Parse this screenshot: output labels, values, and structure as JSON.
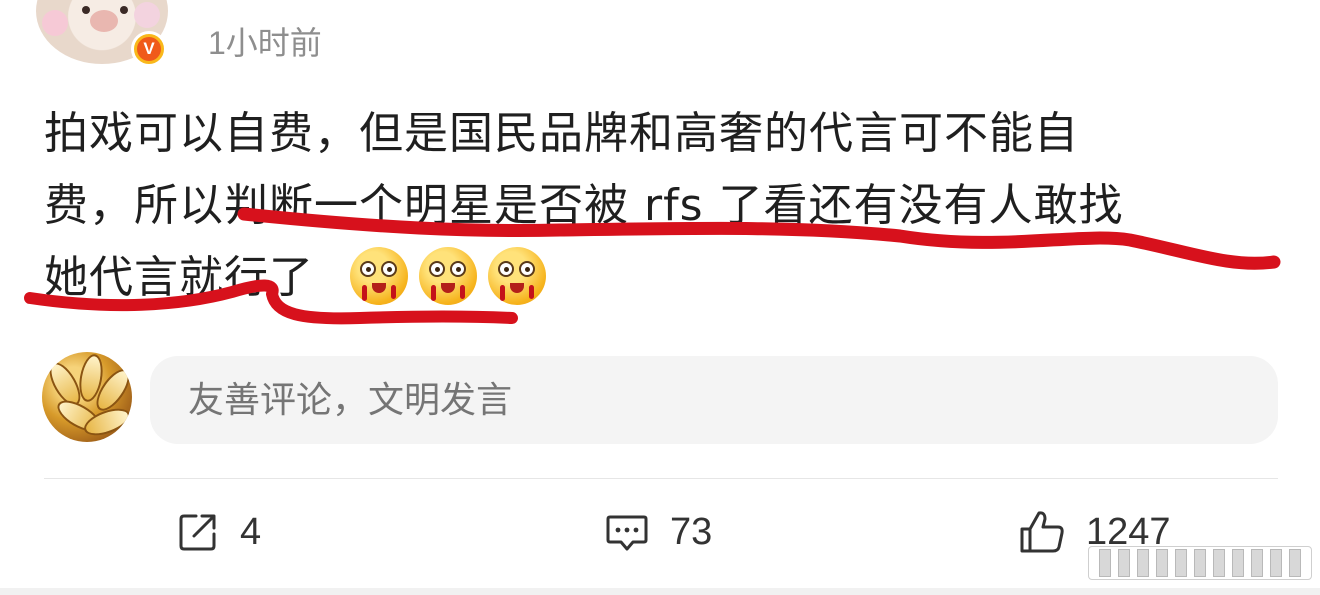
{
  "post": {
    "timestamp": "1小时前",
    "verified_badge": "V",
    "text": "拍戏可以自费，但是国民品牌和高奢的代言可不能自\n费，所以判断一个明星是否被 rfs 了看还有没有人敢找\n她代言就行了",
    "emoji": [
      "bleeding-emoji",
      "bleeding-emoji",
      "bleeding-emoji"
    ],
    "annotation_color": "#d7111c"
  },
  "comment_box": {
    "placeholder": "友善评论，文明发言"
  },
  "actions": {
    "repost_count": "4",
    "comment_count": "73",
    "like_count": "1247"
  },
  "colors": {
    "badge_orange": "#f05a1a",
    "badge_ring": "#f9b81b",
    "input_bg": "#f4f4f4",
    "muted_text": "#8e8e8e"
  }
}
